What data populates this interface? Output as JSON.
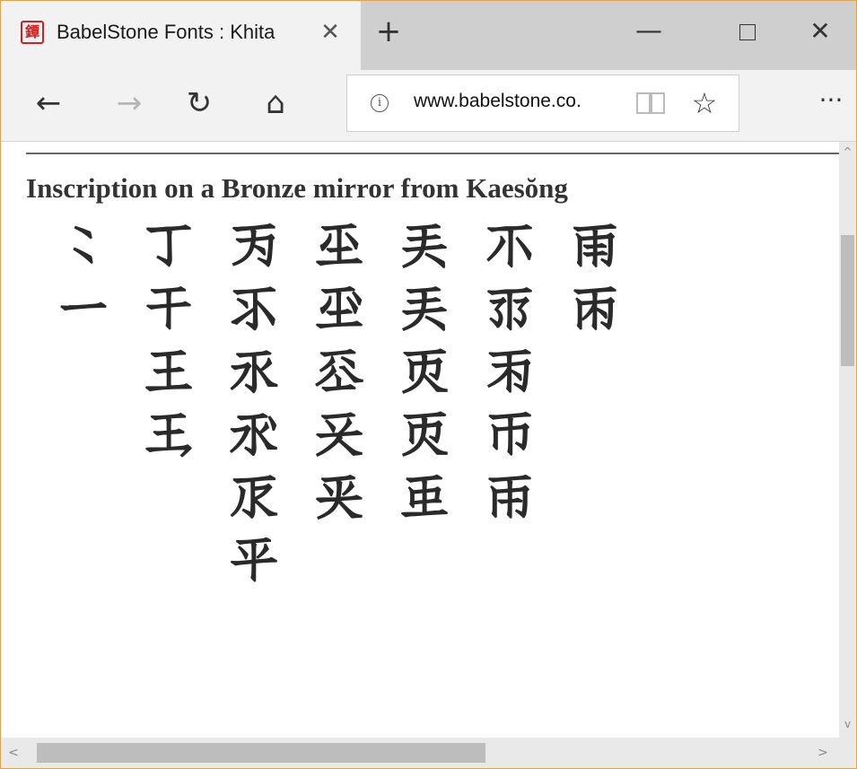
{
  "tab": {
    "title": "BabelStone Fonts : Khita",
    "favicon": "babelstone-favicon",
    "favicon_glyph": "鐔",
    "close_glyph": "✕"
  },
  "newtab_glyph": "+",
  "window_controls": {
    "minimize_glyph": "—",
    "close_glyph": "✕"
  },
  "nav": {
    "back_glyph": "←",
    "forward_glyph": "→",
    "refresh_glyph": "↻",
    "home_glyph": "⌂",
    "info_glyph": "i",
    "url": "www.babelstone.co.",
    "favorite_glyph": "☆",
    "more_glyph": "···"
  },
  "content": {
    "heading": "Inscription on a Bronze mirror from Kaesŏng",
    "columns": [
      [
        "𘬀",
        "𘬁"
      ],
      [
        "𘬂",
        "𘬃",
        "𘬄",
        "𘬅"
      ],
      [
        "𘬆",
        "𘬇",
        "𘬈",
        "𘬉",
        "𘬊",
        "𘬋"
      ],
      [
        "𘬌",
        "𘬍",
        "𘬎",
        "𘬏",
        "𘬐"
      ],
      [
        "𘬑",
        "𘬑",
        "𘬒",
        "𘬒",
        "𘬓"
      ],
      [
        "𘬔",
        "𘬕",
        "𘬖",
        "𘬗",
        "𘬘"
      ],
      [
        "𘬙",
        "𘬚"
      ]
    ]
  },
  "scrollbars": {
    "up_glyph": "^",
    "down_glyph": "v",
    "left_glyph": "<",
    "right_glyph": ">"
  },
  "colors": {
    "window_border": "#e0a34a",
    "favicon_red": "#d02020",
    "tabbar_bg": "#cfcfcf",
    "active_tab_bg": "#f2f2f2"
  }
}
